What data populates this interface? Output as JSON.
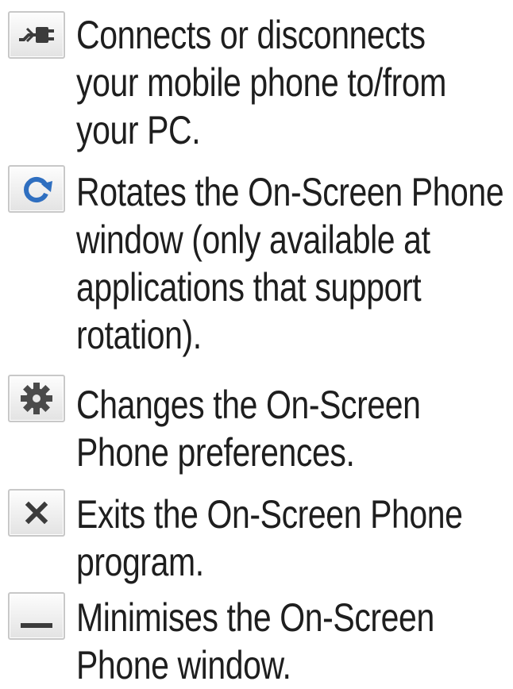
{
  "items": [
    {
      "icon": "connect-icon",
      "lines": [
        "Connects or disconnects",
        "your mobile phone to/from",
        "your PC."
      ]
    },
    {
      "icon": "rotate-icon",
      "lines": [
        "Rotates the On-Screen Phone",
        "window (only available at",
        "applications that support",
        "rotation)."
      ]
    },
    {
      "icon": "gear-icon",
      "lines": [
        "Changes the On-Screen",
        "Phone preferences."
      ]
    },
    {
      "icon": "close-icon",
      "lines": [
        "Exits the On-Screen Phone",
        "program."
      ]
    },
    {
      "icon": "minimise-icon",
      "lines": [
        "Minimises the On-Screen",
        "Phone window."
      ]
    }
  ],
  "colors": {
    "text": "#1e1e1e",
    "icon_blue": "#2f6fc0",
    "icon_gray": "#4a4a4a",
    "icon_border": "#c8c8c8"
  }
}
